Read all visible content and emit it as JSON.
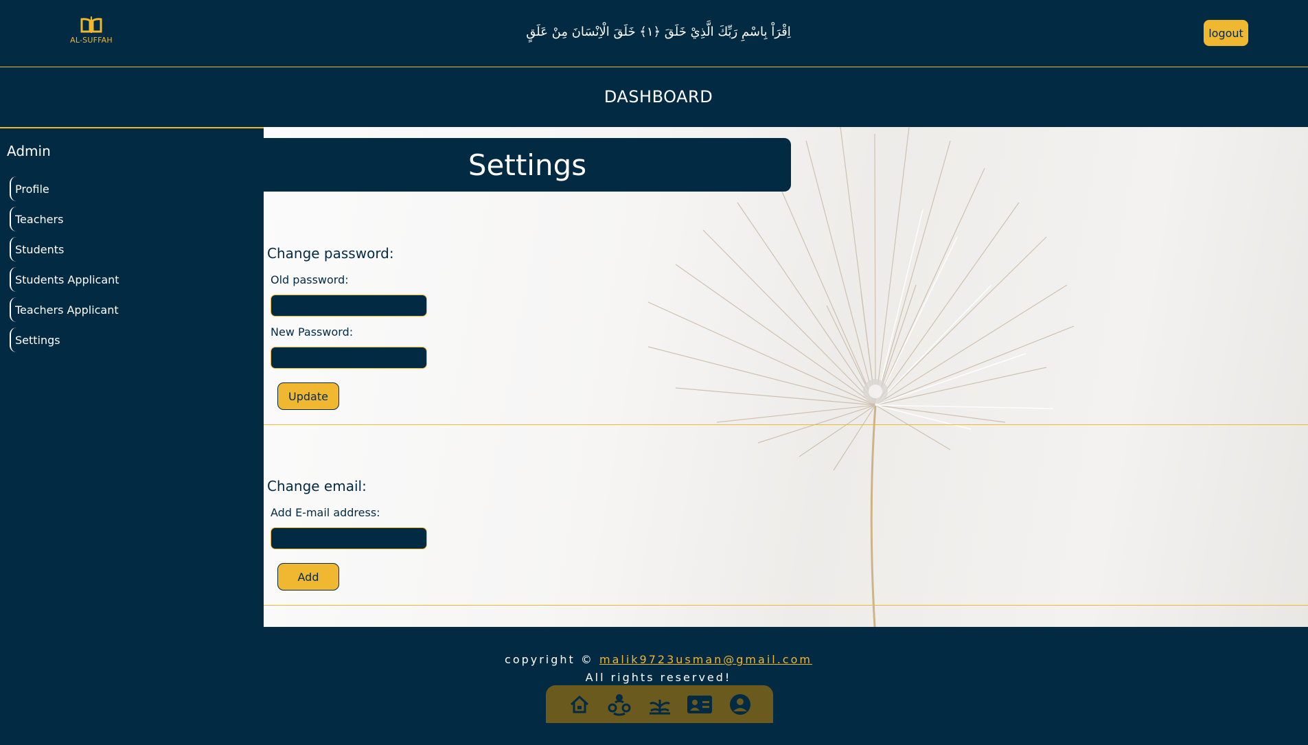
{
  "header": {
    "logo_text": "AL-SUFFAH",
    "verse": "اِقْرَاْ بِاسْمِ رَبِّكَ الَّذِيْ خَلَقَ ﴿١﴾ خَلَقَ الْاِنْسَانَ مِنْ عَلَقٍ",
    "logout_label": "logout"
  },
  "dashboard_title": "DASHBOARD",
  "sidebar": {
    "title": "Admin",
    "items": [
      {
        "label": "Profile"
      },
      {
        "label": "Teachers"
      },
      {
        "label": "Students"
      },
      {
        "label": "Students Applicant"
      },
      {
        "label": "Teachers Applicant"
      },
      {
        "label": "Settings"
      }
    ]
  },
  "main": {
    "title": "Settings",
    "password_section": {
      "title": "Change password:",
      "old_label": "Old password:",
      "old_value": "",
      "new_label": "New Password:",
      "new_value": "",
      "button_label": "Update"
    },
    "email_section": {
      "title": "Change email:",
      "email_label": "Add E-mail address:",
      "email_value": "",
      "button_label": "Add"
    }
  },
  "footer": {
    "copyright_prefix": "copyright ©",
    "email_link": "malik9723usman@gmail.com",
    "rights": "All rights reserved!",
    "nav_icons": [
      "home-icon",
      "community-icon",
      "plant-icon",
      "contact-card-icon",
      "user-circle-icon"
    ]
  },
  "colors": {
    "navy": "#022a43",
    "gold": "#f0b730",
    "footer_nav": "#6b5a1e"
  }
}
